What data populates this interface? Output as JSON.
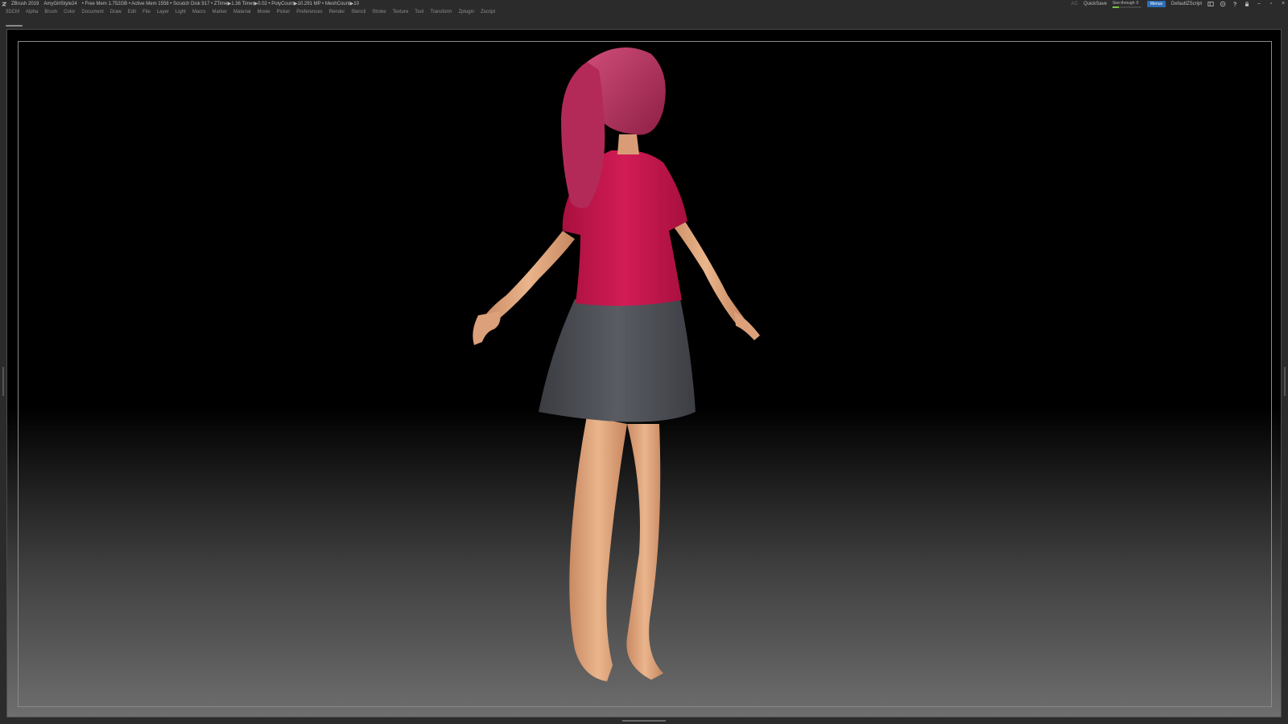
{
  "titlebar": {
    "app": "ZBrush 2019",
    "project": "AmyGirlStyle24",
    "stats": "• Free Mem 1.752GB • Active Mem 1558 • Scratch Disk 917 • ZTime▶1.36 Timer▶0.02 • PolyCount▶10.291 MP • MeshCount▶10",
    "ac_label": "AC",
    "quicksave_label": "QuickSave",
    "seethrough_label": "See-through",
    "seethrough_value": "0",
    "menus_label": "Menus",
    "script_label": "DefaultZScript"
  },
  "menu": [
    "3DCM",
    "Alpha",
    "Brush",
    "Color",
    "Document",
    "Draw",
    "Edit",
    "File",
    "Layer",
    "Light",
    "Macro",
    "Marker",
    "Material",
    "Movie",
    "Picker",
    "Preferences",
    "Render",
    "Stencil",
    "Stroke",
    "Texture",
    "Tool",
    "Transform",
    "Zplugin",
    "Zscript"
  ],
  "colors": {
    "hair": "#b9345f",
    "shirt": "#c7164d",
    "skirt": "#4a4c52",
    "skin": "#e6ad84",
    "accent_blue": "#2d6fb8"
  },
  "icons": [
    "zbrush-logo-icon",
    "layout-icon",
    "palette-icon",
    "help-icon",
    "lock-icon",
    "minimize-icon",
    "restore-icon",
    "close-icon"
  ]
}
